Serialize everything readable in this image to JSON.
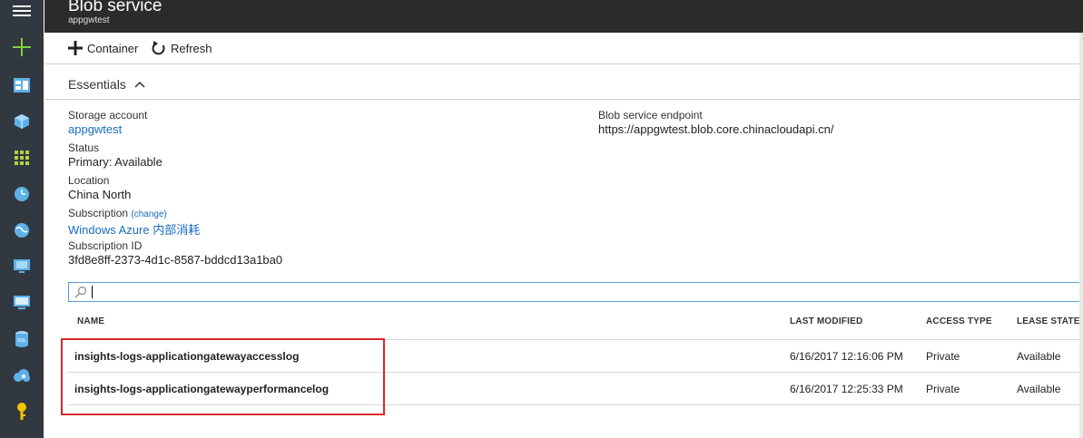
{
  "header": {
    "title": "Blob service",
    "subtitle": "appgwtest"
  },
  "toolbar": {
    "container_label": "Container",
    "refresh_label": "Refresh"
  },
  "essentials": {
    "label": "Essentials",
    "storage_account_label": "Storage account",
    "storage_account_value": "appgwtest",
    "status_label": "Status",
    "status_value": "Primary: Available",
    "location_label": "Location",
    "location_value": "China North",
    "subscription_label": "Subscription",
    "subscription_change": "(change)",
    "subscription_value": "Windows Azure 内部消耗",
    "subscription_id_label": "Subscription ID",
    "subscription_id_value": "3fd8e8ff-2373-4d1c-8587-bddcd13a1ba0",
    "endpoint_label": "Blob service endpoint",
    "endpoint_value": "https://appgwtest.blob.core.chinacloudapi.cn/"
  },
  "search": {
    "value": ""
  },
  "table": {
    "columns": [
      "NAME",
      "LAST MODIFIED",
      "ACCESS TYPE",
      "LEASE STATE"
    ],
    "rows": [
      {
        "name": "insights-logs-applicationgatewayaccesslog",
        "last_modified": "6/16/2017 12:16:06 PM",
        "access_type": "Private",
        "lease_state": "Available"
      },
      {
        "name": "insights-logs-applicationgatewayperformancelog",
        "last_modified": "6/16/2017 12:25:33 PM",
        "access_type": "Private",
        "lease_state": "Available"
      }
    ]
  },
  "colors": {
    "accent": "#1a6cc1",
    "highlight": "#d9262e",
    "nav_bg": "#32383f",
    "header_bg": "#2b2b2b"
  },
  "nav": {
    "icons": [
      "menu-icon",
      "plus-icon",
      "dashboard-icon",
      "cube-icon",
      "grid-icon",
      "clock-icon",
      "globe-icon",
      "vm-icon",
      "monitor-icon",
      "sql-icon",
      "cloud-icon",
      "key-icon"
    ]
  }
}
